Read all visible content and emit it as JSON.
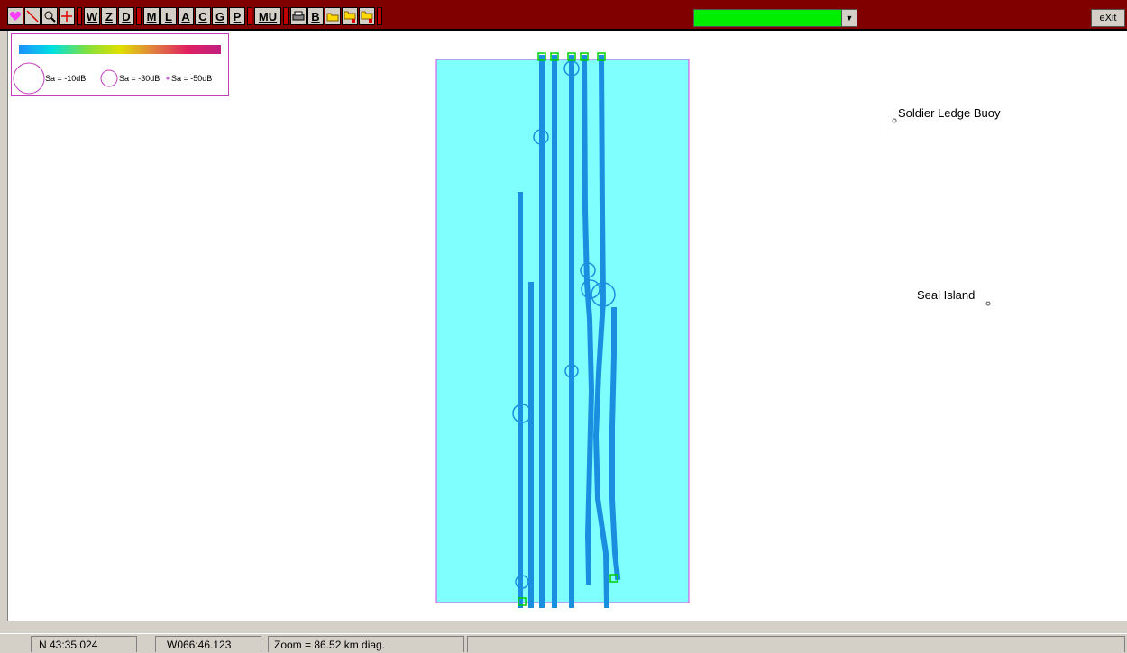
{
  "toolbar": {
    "buttons": [
      "W",
      "Z",
      "D",
      "M",
      "L",
      "A",
      "C",
      "G",
      "P",
      "MU",
      "B"
    ],
    "exit_label": "eXit",
    "combo_value": ""
  },
  "legend": {
    "sa_10": "Sa = -10dB",
    "sa_30": "Sa = -30dB",
    "sa_50": "Sa = -50dB"
  },
  "map": {
    "labels": {
      "soldier_ledge": "Soldier Ledge Buoy",
      "seal_island": "Seal Island"
    },
    "colors": {
      "survey_area": "#80ffff",
      "track": "#1a8fe0",
      "area_border": "#e040e0",
      "marker": "#00d000"
    }
  },
  "status": {
    "lat": "N 43:35.024",
    "lon": "W066:46.123",
    "zoom": "Zoom = 86.52 km diag."
  }
}
